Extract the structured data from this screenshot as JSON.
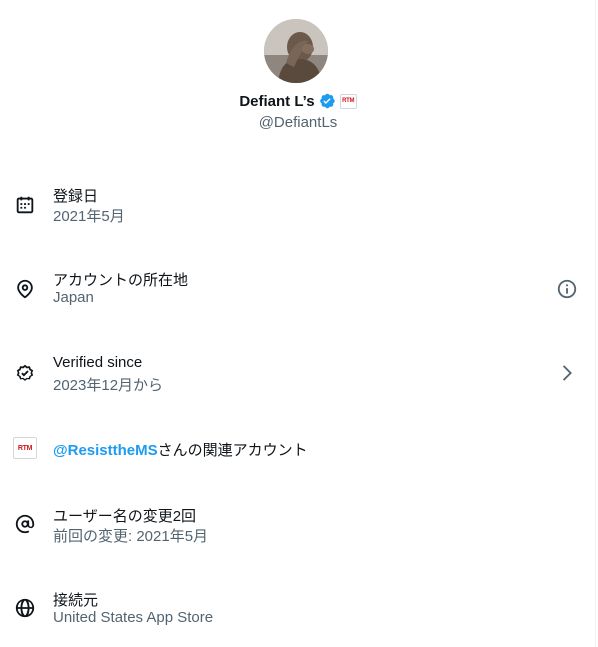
{
  "profile": {
    "display_name": "Defiant L’s",
    "handle": "@DefiantLs",
    "affiliate_badge_text": "RTM",
    "verified_color": "#1d9bf0"
  },
  "rows": {
    "joined": {
      "title": "登録日",
      "value": "2021年5月",
      "icon": "calendar-icon"
    },
    "location": {
      "title": "アカウントの所在地",
      "value": "Japan",
      "icon": "location-pin-icon",
      "right_icon": "info-icon"
    },
    "verified": {
      "title": "Verified since",
      "value": "2023年12月から",
      "icon": "verified-badge-outline-icon",
      "right_icon": "chevron-right-icon"
    },
    "affiliate": {
      "badge_text": "RTM",
      "link": "@ResisttheMS",
      "suffix": "さんの関連アカウント"
    },
    "username_changes": {
      "title": "ユーザー名の変更2回",
      "value": "前回の変更: 2021年5月",
      "icon": "at-icon"
    },
    "connected_via": {
      "title": "接続元",
      "value": "United States App Store",
      "icon": "globe-icon"
    }
  },
  "colors": {
    "text_primary": "#0f1419",
    "text_secondary": "#536471",
    "link": "#1d9bf0"
  }
}
